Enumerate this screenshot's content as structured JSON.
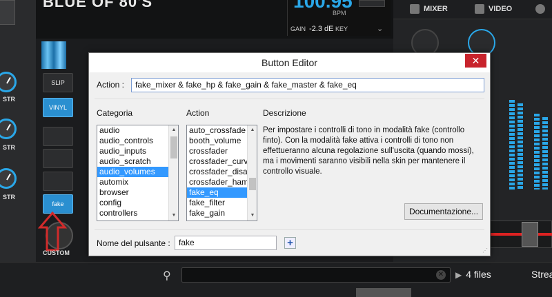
{
  "deck": {
    "title": "BLUE OF 80'S",
    "bpm": "100.95",
    "bpm_label": "BPM",
    "gain_label": "GAIN",
    "gain_value": "-2.3 dE",
    "key_label": "KEY"
  },
  "side_buttons": {
    "slip": "SLIP",
    "vinyl": "VINYL",
    "fake": "fake",
    "custom": "CUSTOM"
  },
  "knob_labels": [
    "STR",
    "STR",
    "STR"
  ],
  "right_tabs": {
    "mixer": "MIXER",
    "video": "VIDEO"
  },
  "browser": {
    "files_count": "4 files",
    "stream_label": "Strea"
  },
  "dialog": {
    "title": "Button Editor",
    "close_glyph": "✕",
    "action_label": "Action :",
    "action_value": "fake_mixer  & fake_hp  & fake_gain  & fake_master  & fake_eq",
    "categoria_label": "Categoria",
    "action_col_label": "Action",
    "descrizione_label": "Descrizione",
    "categories": [
      "audio",
      "audio_controls",
      "audio_inputs",
      "audio_scratch",
      "audio_volumes",
      "automix",
      "browser",
      "config",
      "controllers"
    ],
    "selected_category": "audio_volumes",
    "actions": [
      "auto_crossfade",
      "booth_volume",
      "crossfader",
      "crossfader_curv",
      "crossfader_disal",
      "crossfader_ham",
      "fake_eq",
      "fake_filter",
      "fake_gain"
    ],
    "selected_action": "fake_eq",
    "description": "Per impostare i controlli di tono in modalità fake (controllo finto). Con la modalità fake attiva i controlli di tono non effettueranno alcuna regolazione sull'uscita (quando mossi), ma i movimenti saranno visibili nella skin per mantenere il controllo visuale.",
    "doc_button": "Documentazione...",
    "name_label": "Nome del pulsante :",
    "name_value": "fake",
    "plus_glyph": "+"
  },
  "colors": {
    "accent": "#2aa7e8",
    "selection": "#3399ff",
    "close": "#c8232c",
    "arrow": "#d22b2b"
  }
}
